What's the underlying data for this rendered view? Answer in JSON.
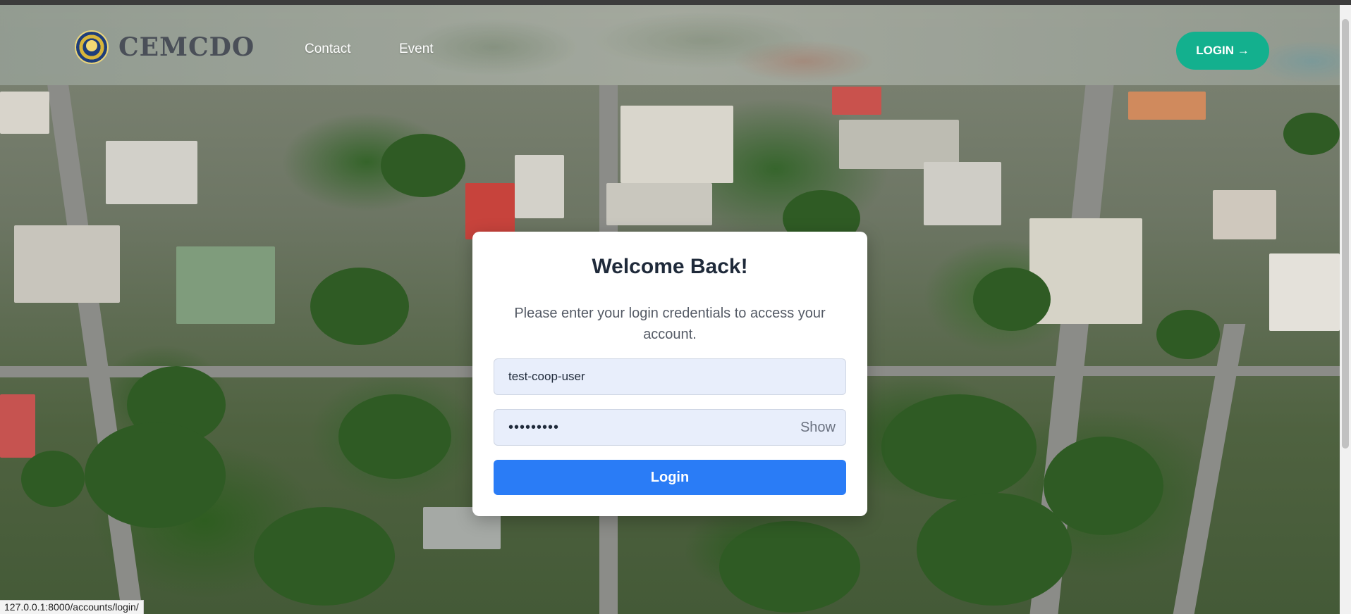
{
  "browser": {
    "status_url": "127.0.0.1:8000/accounts/login/"
  },
  "navbar": {
    "brand_name": "CEMCDO",
    "logo_icon": "seal-logo-icon",
    "links": [
      {
        "label": "Contact"
      },
      {
        "label": "Event"
      }
    ],
    "login_button_label": "LOGIN →"
  },
  "login_card": {
    "title": "Welcome Back!",
    "subtitle": "Please enter your login credentials to access your account.",
    "username": {
      "value": "test-coop-user"
    },
    "password": {
      "value": "•••••••••",
      "toggle_label": "Show"
    },
    "submit_label": "Login"
  },
  "colors": {
    "accent_green": "#13b08e",
    "primary_blue": "#2a7cf6",
    "input_bg": "#e8eefb",
    "title_text": "#1f2a3a"
  }
}
